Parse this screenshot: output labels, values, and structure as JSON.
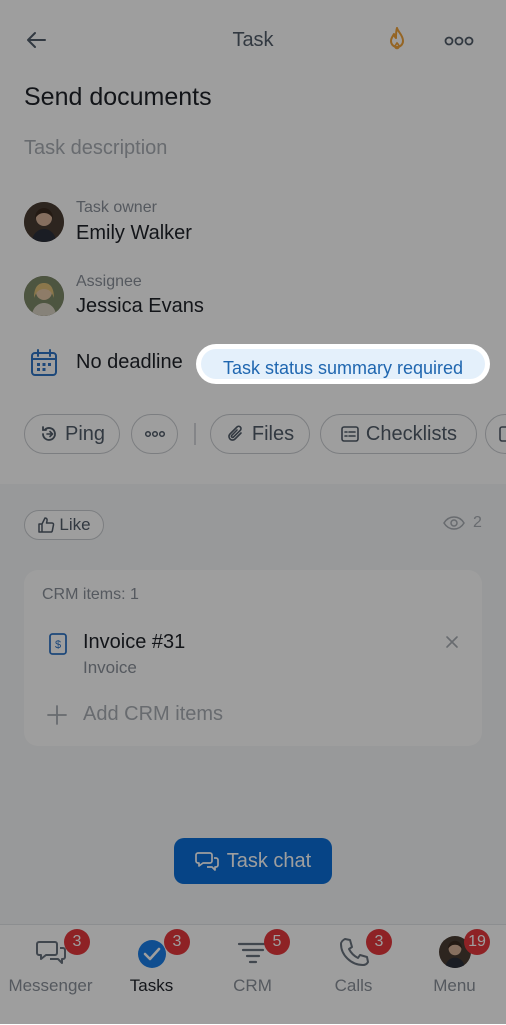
{
  "header": {
    "title": "Task"
  },
  "task": {
    "name": "Send documents",
    "description_placeholder": "Task description"
  },
  "owner": {
    "label": "Task owner",
    "name": "Emily Walker"
  },
  "assignee": {
    "label": "Assignee",
    "name": "Jessica Evans"
  },
  "deadline": {
    "text": "No deadline"
  },
  "hint": {
    "text": "Task status summary required"
  },
  "actions": {
    "ping": "Ping",
    "files": "Files",
    "checklists": "Checklists"
  },
  "social": {
    "like": "Like",
    "views": "2"
  },
  "crm": {
    "header": "CRM items: 1",
    "items": [
      {
        "title": "Invoice #31",
        "type": "Invoice"
      }
    ],
    "add_label": "Add CRM items"
  },
  "chat_button": "Task chat",
  "tabs": [
    {
      "label": "Messenger",
      "badge": "3",
      "icon": "chat-bubbles-icon"
    },
    {
      "label": "Tasks",
      "badge": "3",
      "icon": "check-circle-icon"
    },
    {
      "label": "CRM",
      "badge": "5",
      "icon": "funnel-icon"
    },
    {
      "label": "Calls",
      "badge": "3",
      "icon": "phone-icon"
    },
    {
      "label": "Menu",
      "badge": "19",
      "icon": "avatar"
    }
  ],
  "colors": {
    "accent": "#0b6fd8",
    "badge": "#e5383c",
    "hint_bg": "#e4f0fb",
    "hint_text": "#2067b0",
    "fire": "#f0a33a"
  }
}
